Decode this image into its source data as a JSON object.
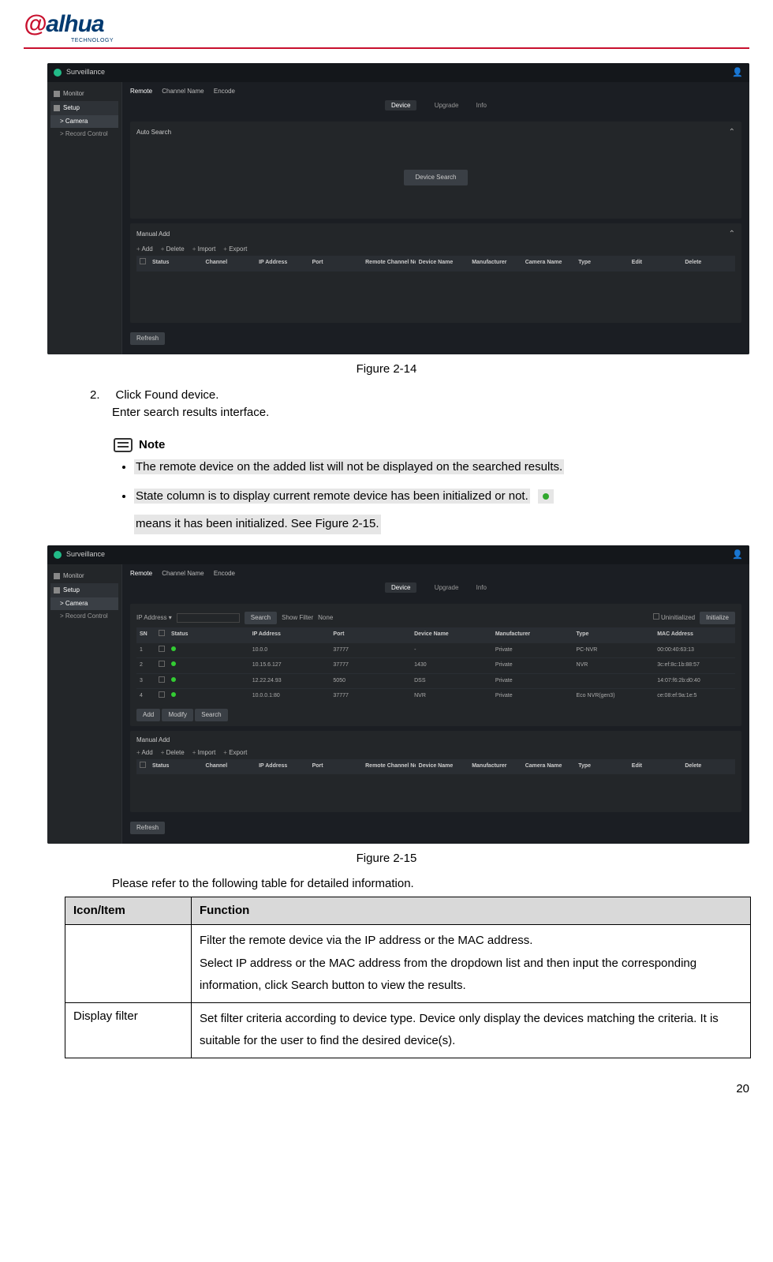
{
  "logo": {
    "name": "alhua",
    "sub": "TECHNOLOGY"
  },
  "figure1": {
    "caption": "Figure 2-14",
    "title": "Surveillance",
    "sidebar": {
      "monitor": "Monitor",
      "setup": "Setup",
      "camera": "> Camera",
      "record": "> Record Control"
    },
    "tabs": {
      "t1": "Remote",
      "t2": "Channel Name",
      "t3": "Encode"
    },
    "center_tabs": {
      "c1": "Device",
      "c2": "Upgrade",
      "c3": "Info"
    },
    "search_label": "Auto Search",
    "center_btn": "Device Search",
    "manual": "Manual Add",
    "toolbar": {
      "a": "Add",
      "b": "Delete",
      "c": "Import",
      "d": "Export"
    },
    "cols": {
      "c1": "Status",
      "c2": "Channel",
      "c3": "IP Address",
      "c4": "Port",
      "c5": "Remote Channel No.",
      "c6": "Device Name",
      "c7": "Manufacturer",
      "c8": "Camera Name",
      "c9": "Type",
      "c10": "Edit",
      "c11": "Delete"
    },
    "refresh": "Refresh"
  },
  "step": {
    "num": "2.",
    "line1": "Click Found device.",
    "line2": "Enter search results interface."
  },
  "note": {
    "label": "Note",
    "item1": "The remote device on the added list will not be displayed on the searched results.",
    "item2a": "State column is to display current remote device has been initialized or not.",
    "item2b": "means it has been initialized. See Figure 2-15."
  },
  "figure2": {
    "caption": "Figure 2-15",
    "title": "Surveillance",
    "filter": {
      "ip": "IP Address ▾",
      "search": "Search",
      "show": "Show Filter",
      "none": "None",
      "uninit": "Uninitialized",
      "init": "Initialize"
    },
    "cols": {
      "sn": "SN",
      "status": "Status",
      "ip": "IP Address",
      "port": "Port",
      "dev": "Device Name",
      "manu": "Manufacturer",
      "type": "Type",
      "mac": "MAC Address"
    },
    "rows": [
      {
        "sn": "1",
        "ip": "10.0.0",
        "port": "37777",
        "dev": "-",
        "manu": "Private",
        "type": "PC-NVR",
        "mac": "00:00:40:63:13"
      },
      {
        "sn": "2",
        "ip": "10.15.6.127",
        "port": "37777",
        "dev": "1430",
        "manu": "Private",
        "type": "NVR",
        "mac": "3c:ef:8c:1b:88:57"
      },
      {
        "sn": "3",
        "ip": "12.22.24.93",
        "port": "5050",
        "dev": "DSS",
        "manu": "Private",
        "type": "",
        "mac": "14:07:f6:2b:d0:40"
      },
      {
        "sn": "4",
        "ip": "10.0.0.1:80",
        "port": "37777",
        "dev": "NVR",
        "manu": "Private",
        "type": "Eco NVR(gen3)",
        "mac": "ce:08:ef:9a:1e:5"
      }
    ],
    "btns": {
      "add": "Add",
      "modify": "Modify",
      "search": "Search"
    },
    "manual": "Manual Add",
    "toolbar": {
      "a": "Add",
      "b": "Delete",
      "c": "Import",
      "d": "Export"
    },
    "cols2": {
      "c1": "Status",
      "c2": "Channel",
      "c3": "IP Address",
      "c4": "Port",
      "c5": "Remote Channel No.",
      "c6": "Device Name",
      "c7": "Manufacturer",
      "c8": "Camera Name",
      "c9": "Type",
      "c10": "Edit",
      "c11": "Delete"
    },
    "refresh": "Refresh"
  },
  "table_intro": "Please refer to the following table for detailed information.",
  "info_table": {
    "h1": "Icon/Item",
    "h2": "Function",
    "r1_item": "",
    "r1_func": "Filter the remote device via the IP address or the MAC address.\nSelect IP address or the MAC address from the dropdown list and then input the corresponding information, click Search button to view the results.",
    "r2_item": "Display filter",
    "r2_func": "Set filter criteria according to device type. Device only display the devices matching the criteria. It is suitable for the user to find the desired device(s)."
  },
  "page_number": "20"
}
